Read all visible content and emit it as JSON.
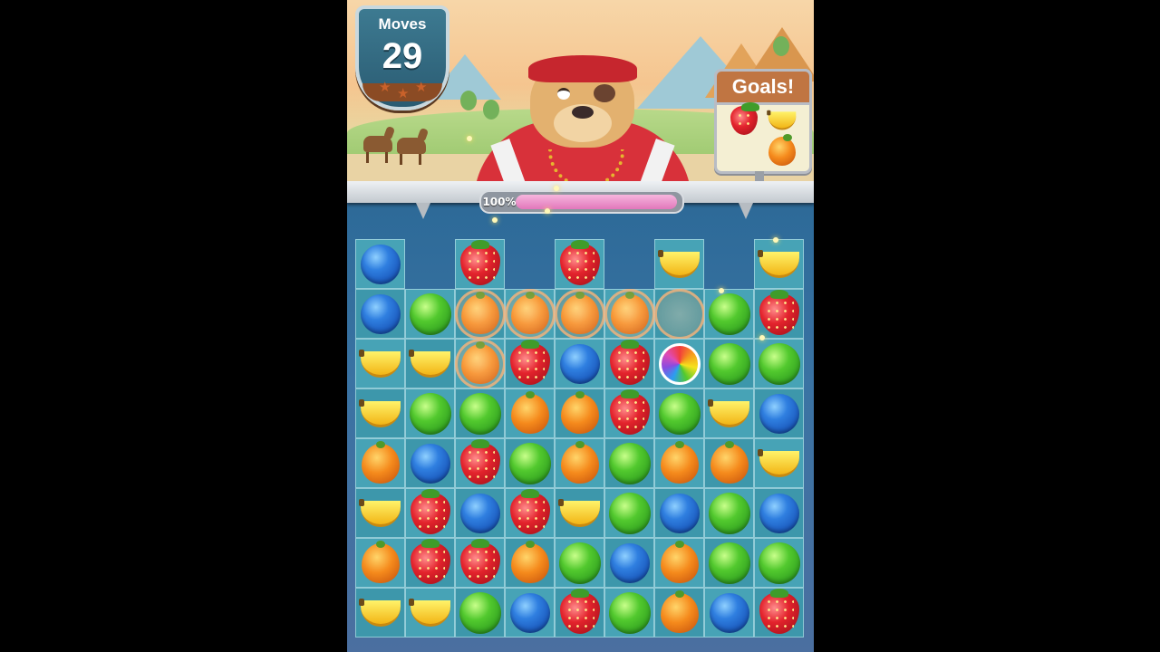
{
  "hud": {
    "moves_label": "Moves",
    "moves_value": "29",
    "stars_filled": 0,
    "stars_total": 3
  },
  "goals": {
    "title": "Goals!",
    "items": [
      "strawberry",
      "banana",
      "orange"
    ]
  },
  "progress": {
    "label": "100%",
    "value": 1.0
  },
  "colors": {
    "moves_badge": "#2f6b84",
    "goals_header": "#c07542",
    "progress_fill": "#e277bb",
    "board_tile": "#47a3b6"
  },
  "board": {
    "rows": 8,
    "cols": 9,
    "grid": [
      [
        "blueberry",
        "",
        "strawberry",
        "",
        "strawberry",
        "",
        "banana",
        "",
        "banana"
      ],
      [
        "blueberry",
        "apple",
        "orange",
        "orange",
        "orange",
        "orange",
        "burst",
        "apple",
        "strawberry"
      ],
      [
        "banana",
        "banana",
        "orange",
        "strawberry",
        "blueberry",
        "strawberry",
        "rainbow",
        "apple",
        "apple"
      ],
      [
        "banana",
        "apple",
        "apple",
        "orange",
        "orange",
        "strawberry",
        "apple",
        "banana",
        "blueberry"
      ],
      [
        "orange",
        "blueberry",
        "strawberry",
        "apple",
        "orange",
        "apple",
        "orange",
        "orange",
        "banana"
      ],
      [
        "banana",
        "strawberry",
        "blueberry",
        "strawberry",
        "banana",
        "apple",
        "blueberry",
        "apple",
        "blueberry"
      ],
      [
        "orange",
        "strawberry",
        "strawberry",
        "orange",
        "apple",
        "blueberry",
        "orange",
        "apple",
        "apple"
      ],
      [
        "banana",
        "banana",
        "apple",
        "blueberry",
        "strawberry",
        "apple",
        "orange",
        "blueberry",
        "strawberry"
      ]
    ],
    "exploding": [
      [
        1,
        2
      ],
      [
        1,
        3
      ],
      [
        1,
        4
      ],
      [
        1,
        5
      ],
      [
        1,
        6
      ],
      [
        2,
        2
      ]
    ]
  }
}
